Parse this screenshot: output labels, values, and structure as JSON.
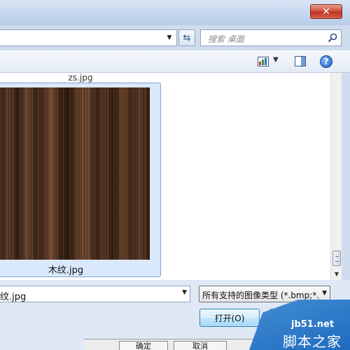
{
  "window": {
    "close_label": "✕"
  },
  "address": {
    "value": "",
    "dropdown_icon": "chevron-down-icon"
  },
  "search": {
    "placeholder": "搜索 桌面"
  },
  "toolbar": {
    "view_icon": "view-mode-icon",
    "pane_icon": "preview-pane-icon",
    "help_label": "?"
  },
  "content": {
    "items": [
      {
        "label": "zs.jpg"
      },
      {
        "label": "木纹.jpg"
      }
    ]
  },
  "bottom": {
    "filename_value": "纹.jpg",
    "filter_value": "所有支持的图像类型 (*.bmp;*.j",
    "open_label": "打开(O)",
    "cancel_label": ""
  },
  "underlying": {
    "ok_label": "确定",
    "cancel_label": "取消"
  },
  "watermark": {
    "site": "jb51.net",
    "name": "脚本之家"
  },
  "colors": {
    "accent": "#3c7fb1",
    "selection": "#d9e8fb",
    "close": "#c0341f"
  }
}
